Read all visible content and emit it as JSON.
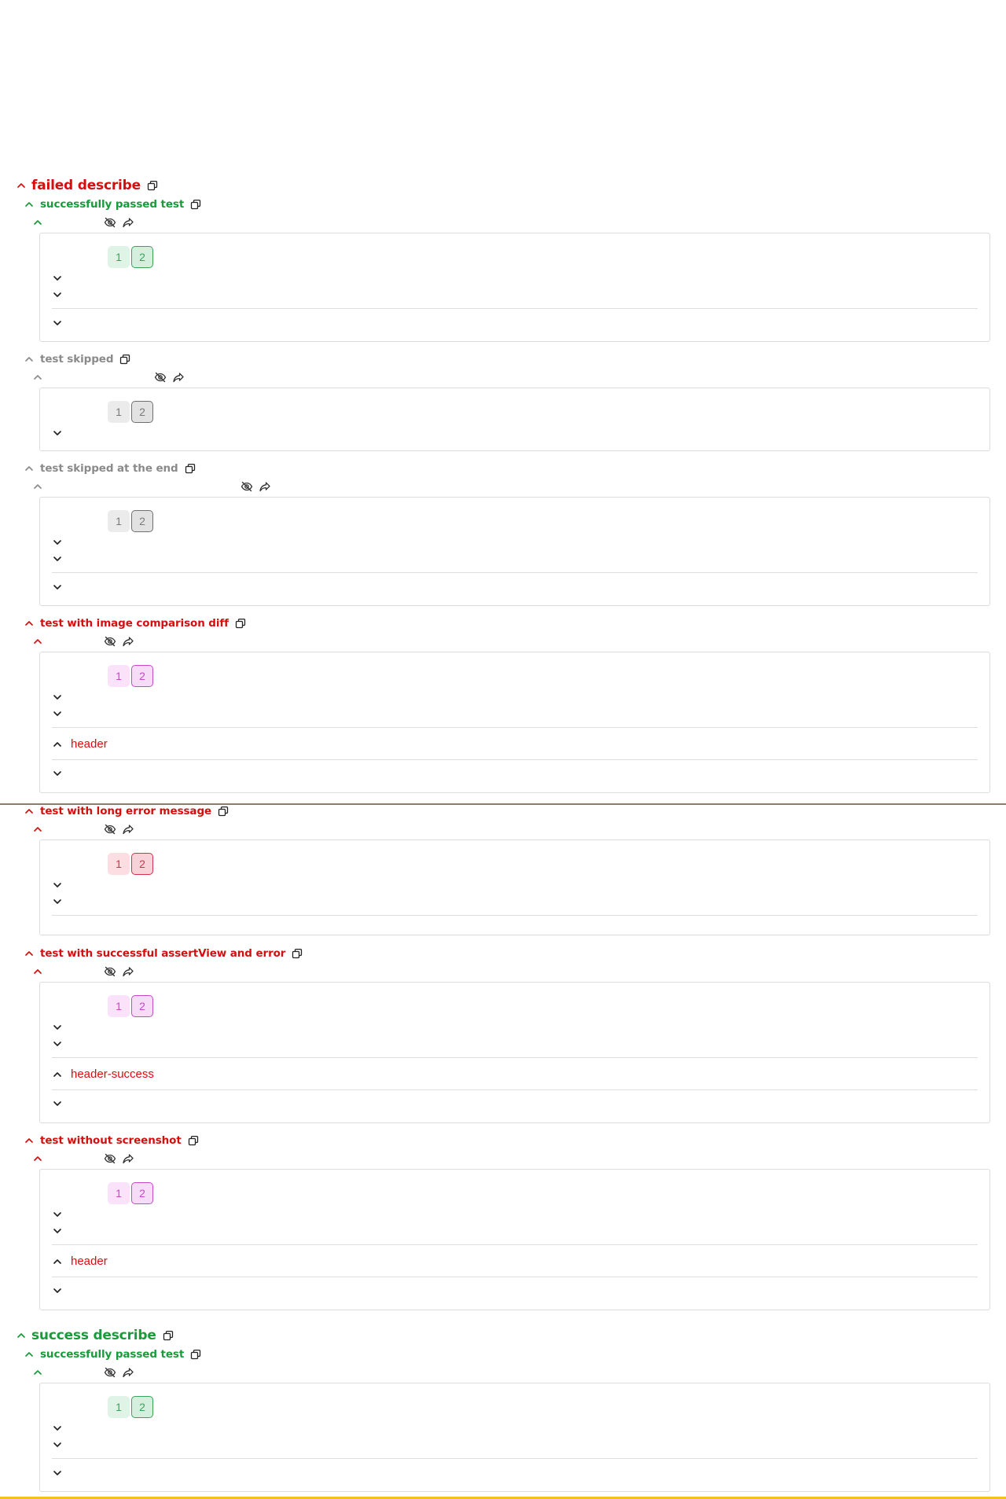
{
  "describes": [
    {
      "title": "failed describe",
      "status": "fail"
    },
    {
      "title": "success describe",
      "status": "pass"
    }
  ],
  "tests": [
    {
      "title": "successfully passed test",
      "status": "pass"
    },
    {
      "title": "test skipped",
      "status": "skip"
    },
    {
      "title": "test skipped at the end",
      "status": "skip"
    },
    {
      "title": "test with image comparison diff",
      "status": "fail"
    },
    {
      "title": "test with long error message",
      "status": "fail"
    },
    {
      "title": "test with successful assertView and error",
      "status": "fail"
    },
    {
      "title": "test without screenshot",
      "status": "fail"
    },
    {
      "title": "successfully passed test",
      "status": "pass"
    }
  ],
  "attempts": [
    "1",
    "2"
  ],
  "states": [
    "header",
    "header-success",
    "header"
  ],
  "colors": {
    "fail": "#d40f0f",
    "pass": "#1a9a3b",
    "skip": "#8a8a8a"
  },
  "icons": {
    "copy": "copy-icon",
    "hide": "eye-off-icon",
    "share": "share-icon",
    "chevron_up": "chevron-up-icon",
    "chevron_down": "chevron-down-icon"
  }
}
